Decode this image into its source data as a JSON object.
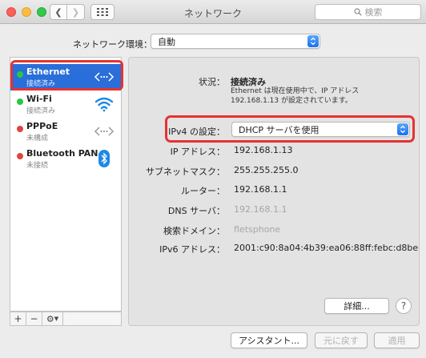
{
  "window": {
    "title": "ネットワーク",
    "search_placeholder": "検索"
  },
  "location": {
    "label": "ネットワーク環境：",
    "value": "自動"
  },
  "services": [
    {
      "name": "Ethernet",
      "status": "接続済み",
      "status_color": "#27c93f",
      "icon": "ethernet-icon",
      "selected": true
    },
    {
      "name": "Wi-Fi",
      "status": "接続済み",
      "status_color": "#27c93f",
      "icon": "wifi-icon",
      "selected": false
    },
    {
      "name": "PPPoE",
      "status": "未構成",
      "status_color": "#e0443e",
      "icon": "ethernet-icon",
      "selected": false
    },
    {
      "name": "Bluetooth PAN",
      "status": "未接続",
      "status_color": "#e0443e",
      "icon": "bluetooth-icon",
      "selected": false
    }
  ],
  "sidebar_controls": {
    "add": "+",
    "remove": "−",
    "action": "⚙"
  },
  "detail": {
    "status_label": "状況：",
    "status_value": "接続済み",
    "status_note": "Ethernet は現在使用中で、IP アドレス 192.168.1.13 が設定されています。",
    "ipv4_label": "IPv4 の設定：",
    "ipv4_value": "DHCP サーバを使用",
    "ip_label": "IP アドレス：",
    "ip_value": "192.168.1.13",
    "subnet_label": "サブネットマスク：",
    "subnet_value": "255.255.255.0",
    "router_label": "ルーター：",
    "router_value": "192.168.1.1",
    "dns_label": "DNS サーバ：",
    "dns_value": "192.168.1.1",
    "search_domain_label": "検索ドメイン：",
    "search_domain_value": "fletsphone",
    "ipv6_label": "IPv6 アドレス：",
    "ipv6_value": "2001:c90:8a04:4b39:ea06:88ff:febc:d8be",
    "advanced_button": "詳細...",
    "help_button": "?"
  },
  "footer": {
    "assistant_button": "アシスタント...",
    "revert_button": "元に戻す",
    "apply_button": "適用"
  },
  "colors": {
    "selection": "#2a6ed9",
    "highlight": "#e63232",
    "connected": "#27c93f",
    "disconnected": "#e0443e",
    "accent_blue": "#1a70ef"
  }
}
